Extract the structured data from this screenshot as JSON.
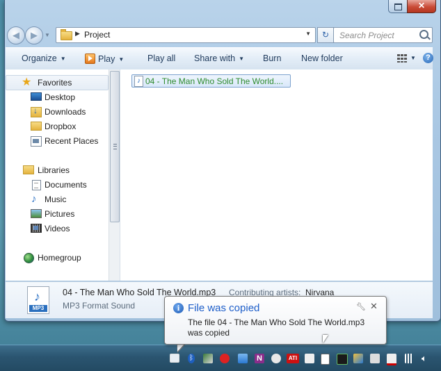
{
  "window": {
    "address": {
      "crumb": "Project"
    },
    "search": {
      "placeholder": "Search Project"
    }
  },
  "toolbar": {
    "organize": "Organize",
    "play": "Play",
    "play_all": "Play all",
    "share_with": "Share with",
    "burn": "Burn",
    "new_folder": "New folder"
  },
  "navpane": {
    "favorites": "Favorites",
    "desktop": "Desktop",
    "downloads": "Downloads",
    "dropbox": "Dropbox",
    "recent_places": "Recent Places",
    "libraries": "Libraries",
    "documents": "Documents",
    "music": "Music",
    "pictures": "Pictures",
    "videos": "Videos",
    "homegroup": "Homegroup"
  },
  "content": {
    "files": [
      {
        "name": "04 - The Man Who Sold The World...."
      }
    ]
  },
  "details": {
    "file_name": "04 - The Man Who Sold The World.mp3",
    "artists_label": "Contributing artists:",
    "artists": "Nirvana",
    "type": "MP3 Format Sound",
    "icon_tag": "MP3"
  },
  "notification": {
    "title": "File was copied",
    "body": "The file 04 - The Man Who Sold The World.mp3 was copied"
  },
  "tray": {
    "icons": [
      "clipboard-icon",
      "bluetooth-icon",
      "music-app-icon",
      "app-red-icon",
      "dropbox-icon",
      "onenote-icon",
      "chat-icon",
      "ati-icon",
      "display-icon",
      "paste-icon",
      "monitor-icon",
      "update-icon",
      "printer-icon",
      "network-error-icon",
      "signal-icon",
      "volume-icon"
    ],
    "ati_label": "ATI",
    "onenote_label": "N"
  }
}
